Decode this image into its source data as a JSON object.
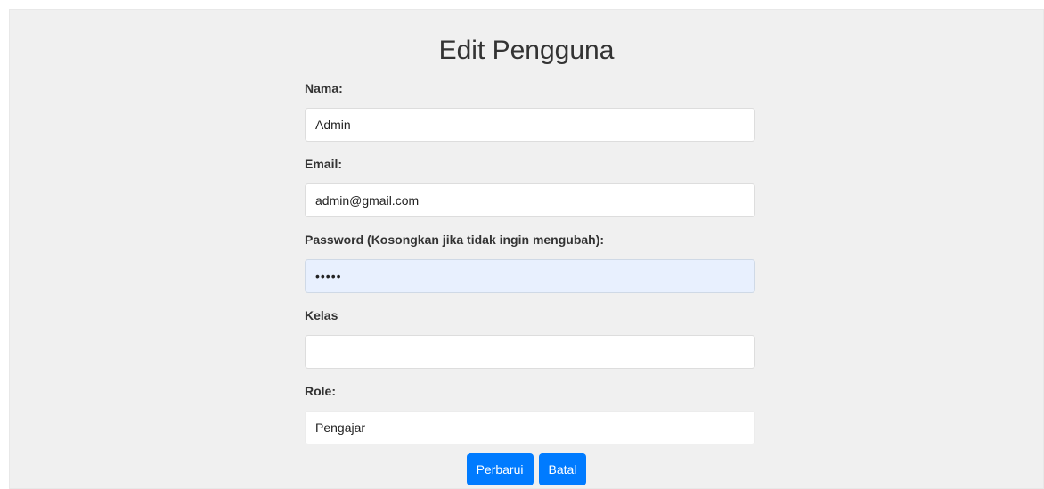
{
  "page": {
    "title": "Edit Pengguna"
  },
  "form": {
    "nama": {
      "label": "Nama:",
      "value": "Admin"
    },
    "email": {
      "label": "Email:",
      "value": "admin@gmail.com"
    },
    "password": {
      "label": "Password (Kosongkan jika tidak ingin mengubah):",
      "value": "•••••"
    },
    "kelas": {
      "label": "Kelas",
      "value": ""
    },
    "role": {
      "label": "Role:",
      "selected": "Pengajar"
    }
  },
  "actions": {
    "update_label": "Perbarui",
    "cancel_label": "Batal"
  },
  "colors": {
    "background": "#f0f0f0",
    "button": "#007bff",
    "autofill": "#e8f0fe"
  }
}
